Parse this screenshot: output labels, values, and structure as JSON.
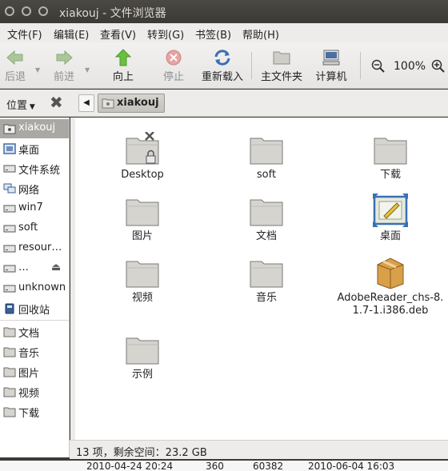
{
  "window": {
    "title": "xiakouj - 文件浏览器"
  },
  "menubar": [
    "文件(F)",
    "编辑(E)",
    "查看(V)",
    "转到(G)",
    "书签(B)",
    "帮助(H)"
  ],
  "toolbar": {
    "back": "后退",
    "forward": "前进",
    "up": "向上",
    "stop": "停止",
    "reload": "重新载入",
    "home": "主文件夹",
    "computer": "计算机",
    "zoom": "100%"
  },
  "location": {
    "places_label": "位置",
    "current": "xiakouj"
  },
  "sidebar": [
    {
      "label": "xiakouj",
      "icon": "home-folder-icon",
      "selected": true
    },
    {
      "label": "桌面",
      "icon": "desktop-icon"
    },
    {
      "label": "文件系统",
      "icon": "drive-icon"
    },
    {
      "label": "网络",
      "icon": "network-icon"
    },
    {
      "label": "win7",
      "icon": "drive-icon"
    },
    {
      "label": "soft",
      "icon": "drive-icon"
    },
    {
      "label": "resour…",
      "icon": "drive-icon"
    },
    {
      "label": "…",
      "icon": "drive-icon"
    },
    {
      "label": "unknown",
      "icon": "drive-icon"
    },
    {
      "label": "回收站",
      "icon": "trash-icon"
    },
    {
      "label": "文档",
      "icon": "folder-icon"
    },
    {
      "label": "音乐",
      "icon": "folder-icon"
    },
    {
      "label": "图片",
      "icon": "folder-icon"
    },
    {
      "label": "视频",
      "icon": "folder-icon"
    },
    {
      "label": "下载",
      "icon": "folder-icon"
    }
  ],
  "files": [
    {
      "name": "Desktop",
      "icon": "folder-locked-icon"
    },
    {
      "name": "soft",
      "icon": "folder-icon"
    },
    {
      "name": "下载",
      "icon": "folder-icon"
    },
    {
      "name": "图片",
      "icon": "folder-icon"
    },
    {
      "name": "文档",
      "icon": "folder-icon"
    },
    {
      "name": "桌面",
      "icon": "desktop-folder-icon"
    },
    {
      "name": "视频",
      "icon": "folder-icon"
    },
    {
      "name": "音乐",
      "icon": "folder-icon"
    },
    {
      "name": "AdobeReader_chs-8.1.7-1.i386.deb",
      "line1": "AdobeReader_chs-8.",
      "line2": "1.7-1.i386.deb",
      "icon": "package-icon"
    },
    {
      "name": "示例",
      "icon": "folder-icon"
    }
  ],
  "status": "13 项，剩余空间：23.2 GB",
  "background": {
    "date1": "2010-04-24 20:24",
    "num1": "360",
    "num2": "60382",
    "date2": "2010-06-04 16:03"
  },
  "colors": {
    "titlebar": "#3c3b37",
    "selection": "#aaa8a4",
    "folder": "#d6d4cf"
  }
}
